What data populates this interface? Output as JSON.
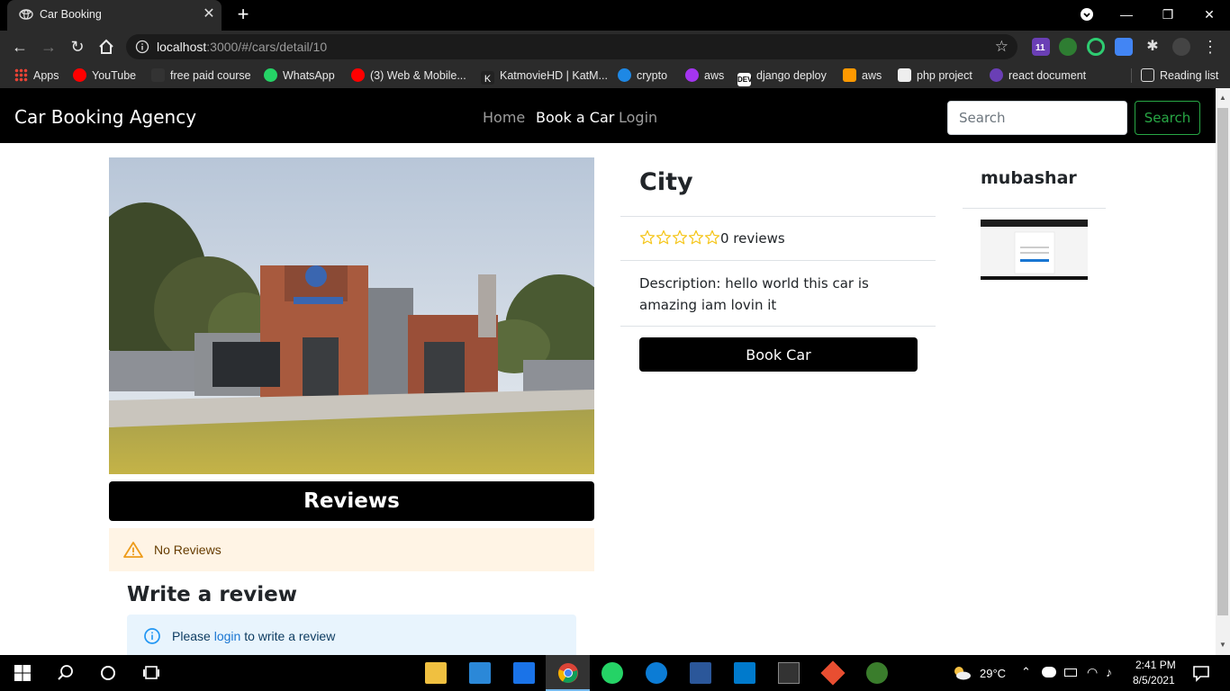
{
  "browser": {
    "tab_title": "Car Booking",
    "url_host": "localhost",
    "url_path": ":3000/#/cars/detail/10",
    "bookmarks": [
      {
        "label": "Apps"
      },
      {
        "label": "YouTube"
      },
      {
        "label": "free paid course"
      },
      {
        "label": "WhatsApp"
      },
      {
        "label": "(3) Web & Mobile..."
      },
      {
        "label": "KatmovieHD | KatM..."
      },
      {
        "label": "crypto"
      },
      {
        "label": "aws"
      },
      {
        "label": "django deploy"
      },
      {
        "label": "aws"
      },
      {
        "label": "php project"
      },
      {
        "label": "react document"
      }
    ],
    "reading_list": "Reading list",
    "extension_badge": "11"
  },
  "navbar": {
    "brand": "Car Booking Agency",
    "links": [
      {
        "label": "Home",
        "active": false
      },
      {
        "label": "Book a Car",
        "active": true
      },
      {
        "label": "Login",
        "active": false
      }
    ],
    "search_placeholder": "Search",
    "search_button": "Search"
  },
  "car": {
    "name": "City",
    "rating_stars": 0,
    "reviews_count_label": "0 reviews",
    "description": "Description: hello world this car is amazing iam lovin it",
    "book_button": "Book Car"
  },
  "owner": {
    "name": "mubashar"
  },
  "reviews": {
    "header": "Reviews",
    "empty_message": "No Reviews",
    "write_title": "Write a review",
    "login_prompt_before": "Please",
    "login_link": "login",
    "login_prompt_after": "to write a review"
  },
  "taskbar": {
    "temperature": "29°C",
    "time": "2:41 PM",
    "date": "8/5/2021"
  },
  "colors": {
    "navbar_bg": "#000000",
    "search_accent": "#28a745",
    "warning_bg": "#fff4e5",
    "info_bg": "#e8f4fd",
    "star_color": "#f5c518"
  }
}
